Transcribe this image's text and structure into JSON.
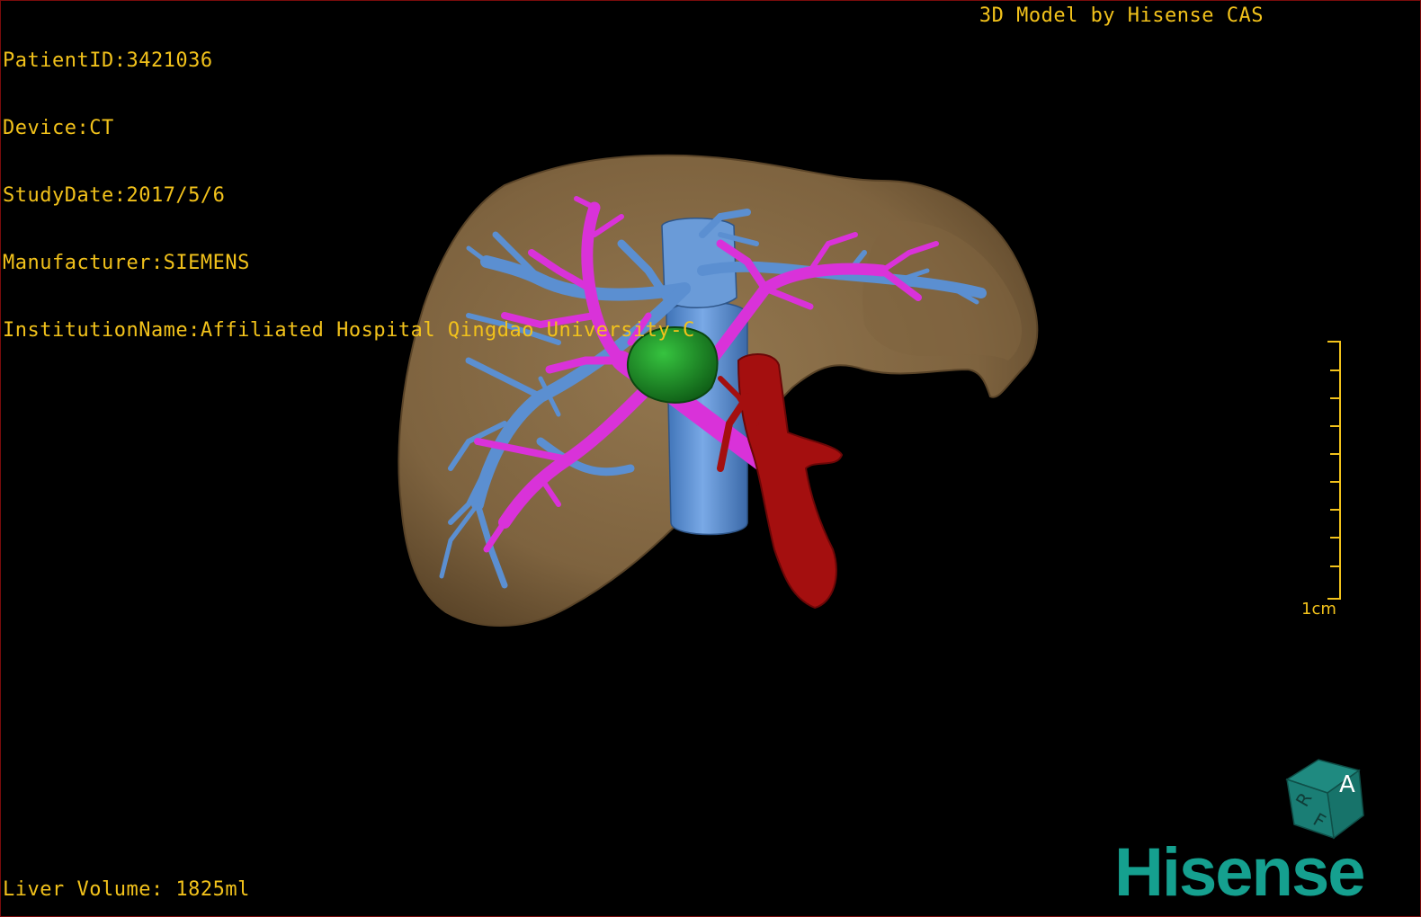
{
  "header": {
    "patient_id": "PatientID:3421036",
    "device": "Device:CT",
    "study_date": "StudyDate:2017/5/6",
    "manufacturer": "Manufacturer:SIEMENS",
    "institution": "InstitutionName:Affiliated Hospital Qingdao University-C",
    "brand": "3D Model by Hisense CAS"
  },
  "footer": {
    "liver_volume": "Liver Volume: 1825ml"
  },
  "scale": {
    "label": "1cm"
  },
  "orientation_cube": {
    "face_top": "A",
    "face_left": "R",
    "face_bottom": "F"
  },
  "logo": {
    "text": "Hisense"
  },
  "colors": {
    "overlay_text": "#f2c21b",
    "liver": "#8a6d48",
    "portal_vein": "#d932d9",
    "hepatic_vein": "#5b8fd1",
    "artery": "#a40f0f",
    "tumor": "#1e8a2a",
    "logo": "#15a08f"
  },
  "model_parts": [
    "liver",
    "hepatic-vein",
    "portal-vein",
    "artery",
    "tumor"
  ]
}
